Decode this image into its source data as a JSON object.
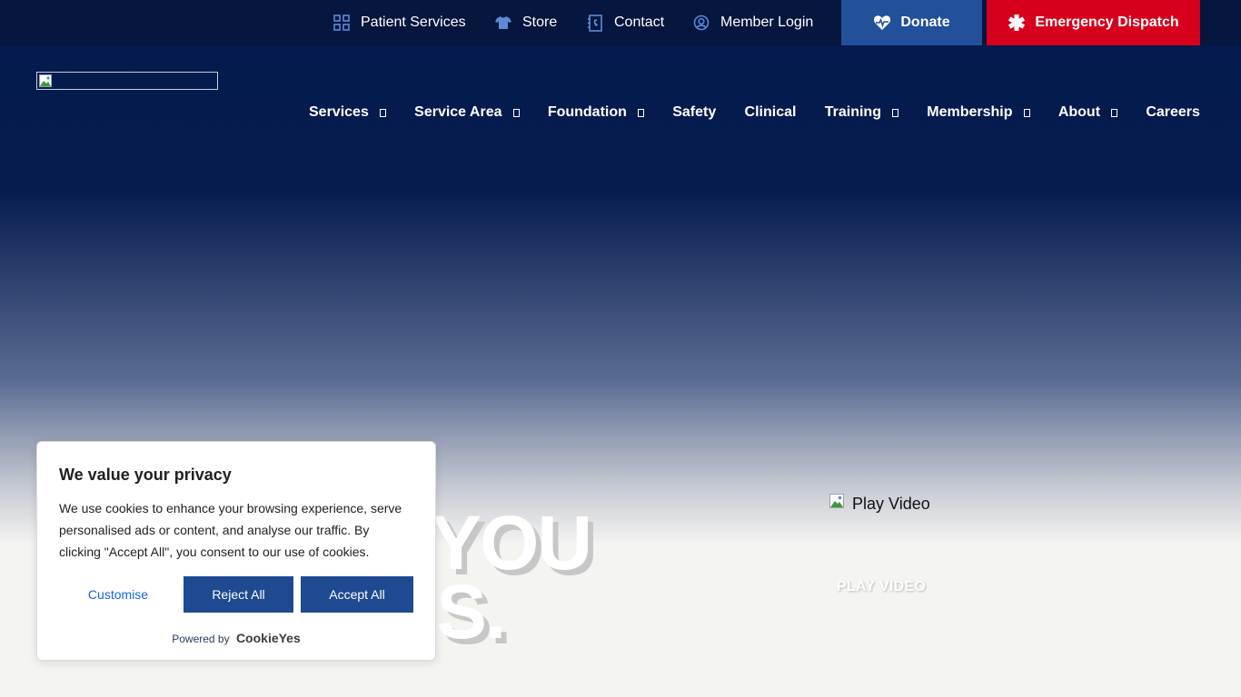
{
  "topbar": {
    "links": [
      {
        "label": "Patient Services",
        "icon": "grid-icon"
      },
      {
        "label": "Store",
        "icon": "tshirt-icon"
      },
      {
        "label": "Contact",
        "icon": "contact-book-icon"
      },
      {
        "label": "Member Login",
        "icon": "user-circle-icon"
      }
    ],
    "donate_label": "Donate",
    "emergency_label": "Emergency Dispatch"
  },
  "nav": {
    "items": [
      {
        "label": "Services",
        "dropdown": true
      },
      {
        "label": "Service Area",
        "dropdown": true
      },
      {
        "label": "Foundation",
        "dropdown": true
      },
      {
        "label": "Safety",
        "dropdown": false
      },
      {
        "label": "Clinical",
        "dropdown": false
      },
      {
        "label": "Training",
        "dropdown": true
      },
      {
        "label": "Membership",
        "dropdown": true
      },
      {
        "label": "About",
        "dropdown": true
      },
      {
        "label": "Careers",
        "dropdown": false
      }
    ]
  },
  "hero": {
    "line1": "YOU",
    "line2": "S.",
    "play_image_alt": "Play Video",
    "play_text": "PLAY VIDEO"
  },
  "cookie": {
    "title": "We value your privacy",
    "body": "We use cookies to enhance your browsing experience, serve personalised ads or content, and analyse our traffic. By clicking \"Accept All\", you consent to our use of cookies.",
    "customise_label": "Customise",
    "reject_label": "Reject All",
    "accept_label": "Accept All",
    "powered_by": "Powered by",
    "brand": "CookieYes"
  },
  "colors": {
    "topbar_bg": "#06163f",
    "donate": "#22509a",
    "emergency": "#d6001c",
    "cookie_button": "#1e4a91"
  }
}
